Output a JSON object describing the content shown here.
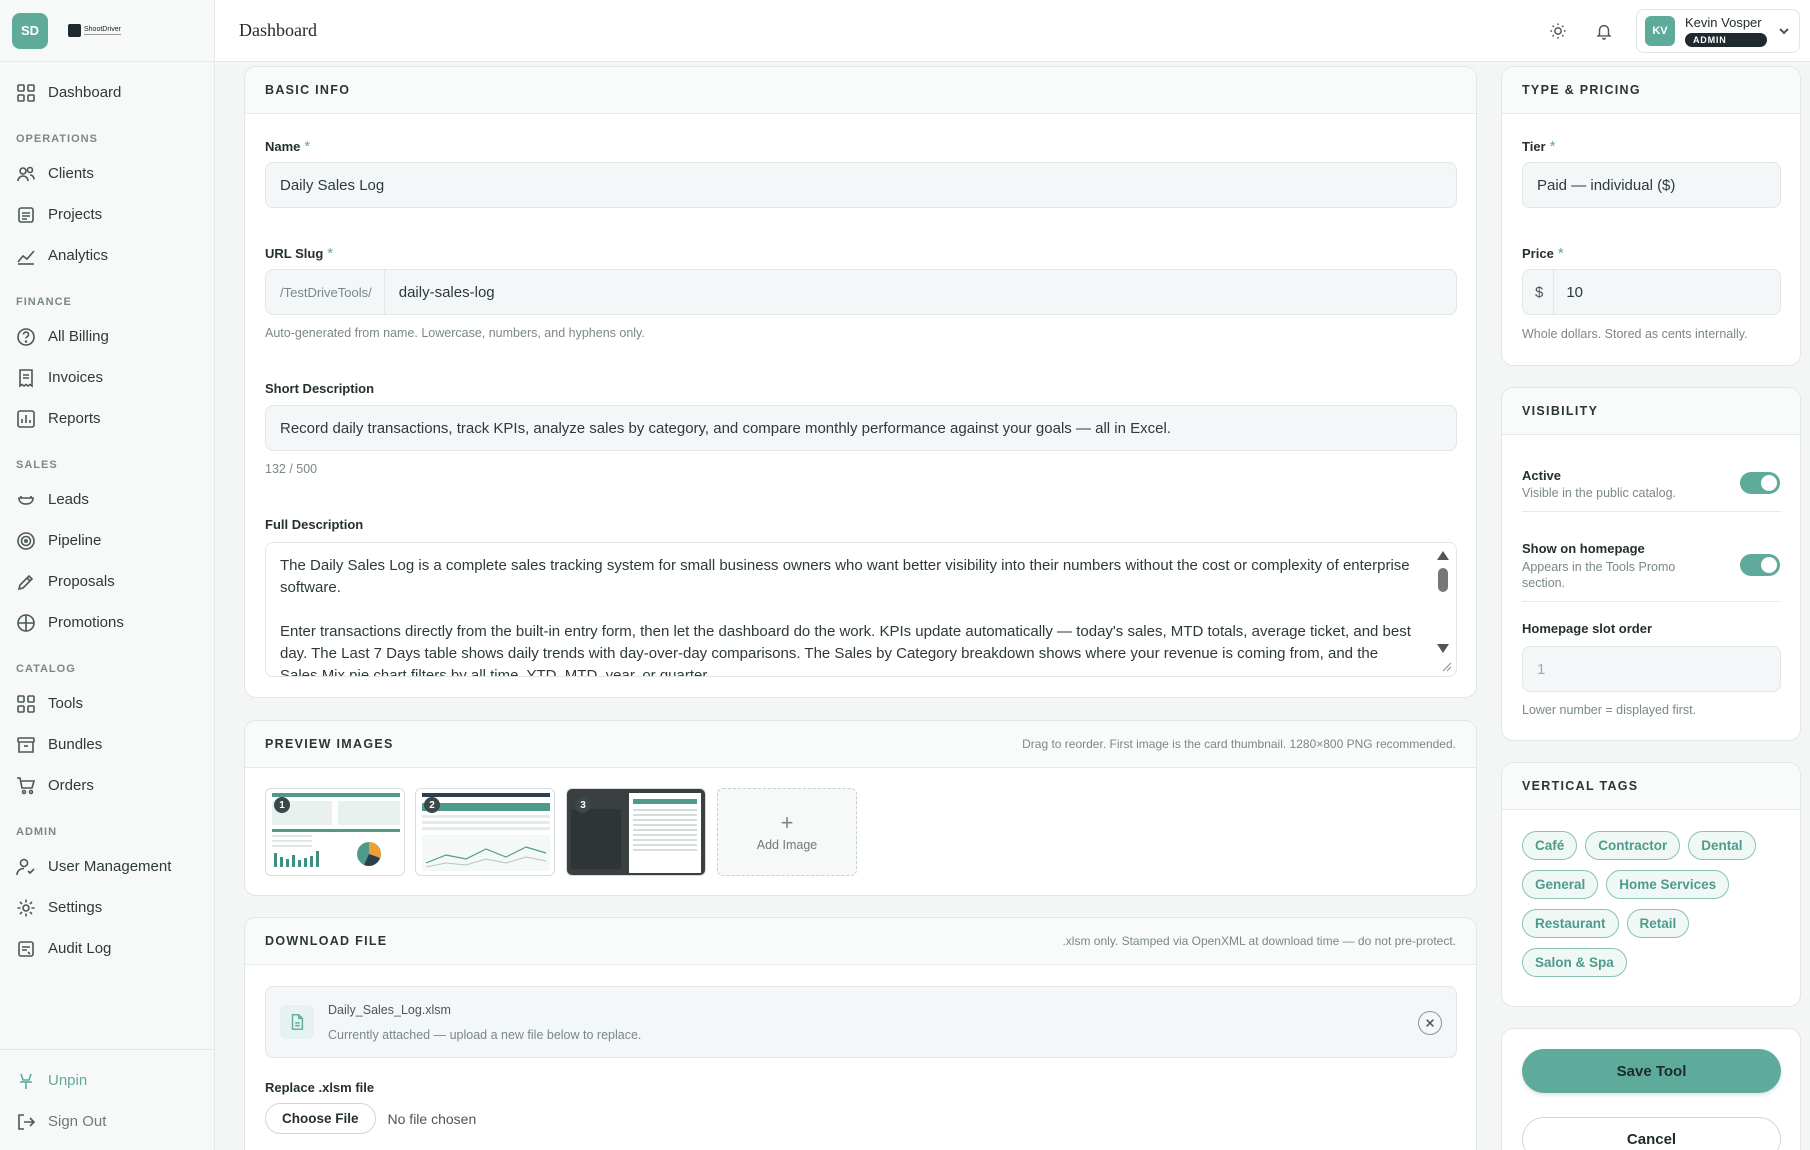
{
  "brand": {
    "initials": "SD",
    "logo_text": "ShootDriver"
  },
  "sidebar": {
    "dashboard": "Dashboard",
    "sections": {
      "operations": "OPERATIONS",
      "finance": "FINANCE",
      "sales": "SALES",
      "catalog": "CATALOG",
      "admin": "ADMIN"
    },
    "items": {
      "clients": "Clients",
      "projects": "Projects",
      "analytics": "Analytics",
      "all_billing": "All Billing",
      "invoices": "Invoices",
      "reports": "Reports",
      "leads": "Leads",
      "pipeline": "Pipeline",
      "proposals": "Proposals",
      "promotions": "Promotions",
      "tools": "Tools",
      "bundles": "Bundles",
      "orders": "Orders",
      "user_management": "User Management",
      "settings": "Settings",
      "audit_log": "Audit Log"
    },
    "unpin": "Unpin",
    "sign_out": "Sign Out"
  },
  "topbar": {
    "title": "Dashboard",
    "user": {
      "initials": "KV",
      "name": "Kevin Vosper",
      "role": "ADMIN"
    }
  },
  "basic_info": {
    "title": "BASIC INFO",
    "name_label": "Name",
    "name_value": "Daily Sales Log",
    "slug_label": "URL Slug",
    "slug_prefix": "/TestDriveTools/",
    "slug_value": "daily-sales-log",
    "slug_help": "Auto-generated from name. Lowercase, numbers, and hyphens only.",
    "short_label": "Short Description",
    "short_value": "Record daily transactions, track KPIs, analyze sales by category, and compare monthly performance against your goals — all in Excel.",
    "short_count": "132 / 500",
    "full_label": "Full Description",
    "full_p1": "The Daily Sales Log is a complete sales tracking system for small business owners who want better visibility into their numbers without the cost or complexity of enterprise software.",
    "full_p2": "Enter transactions directly from the built-in entry form, then let the dashboard do the work. KPIs update automatically — today's sales, MTD totals, average ticket, and best day. The Last 7 Days table shows daily trends with day-over-day comparisons. The Sales by Category breakdown shows where your revenue is coming from, and the Sales Mix pie chart filters by all time, YTD, MTD, year, or quarter."
  },
  "preview_images": {
    "title": "PREVIEW IMAGES",
    "hint": "Drag to reorder. First image is the card thumbnail. 1280×800 PNG recommended.",
    "thumbs": [
      "1",
      "2",
      "3"
    ],
    "add_label": "Add Image",
    "add_glyph": "+"
  },
  "download_file": {
    "title": "DOWNLOAD FILE",
    "hint": ".xlsm only. Stamped via OpenXML at download time — do not pre-protect.",
    "file_name": "Daily_Sales_Log.xlsm",
    "file_sub": "Currently attached — upload a new file below to replace.",
    "replace_label": "Replace .xlsm file",
    "choose_button": "Choose File",
    "no_file": "No file chosen"
  },
  "type_pricing": {
    "title": "TYPE & PRICING",
    "tier_label": "Tier",
    "tier_value": "Paid — individual ($)",
    "price_label": "Price",
    "currency": "$",
    "price_value": "10",
    "price_help": "Whole dollars. Stored as cents internally."
  },
  "visibility": {
    "title": "VISIBILITY",
    "active_label": "Active",
    "active_sub": "Visible in the public catalog.",
    "active_on": true,
    "homepage_label": "Show on homepage",
    "homepage_sub": "Appears in the Tools Promo section.",
    "homepage_on": true,
    "slot_label": "Homepage slot order",
    "slot_placeholder": "1",
    "slot_help": "Lower number = displayed first."
  },
  "vertical_tags": {
    "title": "VERTICAL TAGS",
    "tags": [
      "Café",
      "Contractor",
      "Dental",
      "General",
      "Home Services",
      "Restaurant",
      "Retail",
      "Salon & Spa"
    ]
  },
  "actions": {
    "save": "Save Tool",
    "cancel": "Cancel"
  },
  "colors": {
    "accent": "#5fab9b",
    "dark": "#1f2a2e",
    "border": "#e1e7e6"
  }
}
